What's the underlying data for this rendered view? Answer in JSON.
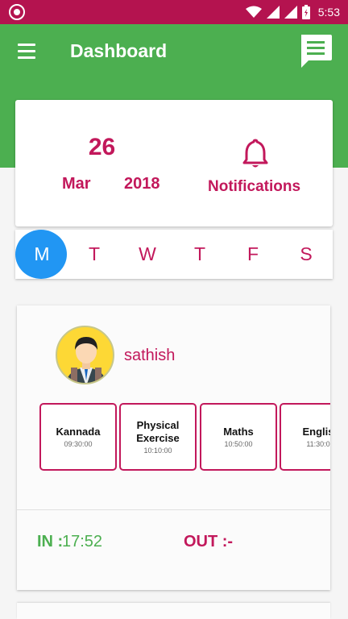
{
  "status_bar": {
    "time": "5:53",
    "color": "#b4134f",
    "icons": [
      "notification-circle-icon",
      "wifi-icon",
      "signal-icon",
      "signal-icon",
      "battery-icon"
    ]
  },
  "app_bar": {
    "title": "Dashboard",
    "color": "#4caf50",
    "icons": [
      "menu-icon",
      "chat-icon"
    ]
  },
  "date_card": {
    "day": "26",
    "month": "Mar",
    "year": "2018",
    "notifications_label": "Notifications",
    "icon": "bell-icon",
    "accent": "#c2185b"
  },
  "week": {
    "days": [
      "M",
      "T",
      "W",
      "T",
      "F",
      "S"
    ],
    "selected": "M",
    "selected_color": "#2196f3"
  },
  "student": {
    "name": "sathish",
    "avatar_icon": "student-avatar-icon",
    "subjects": [
      {
        "name": "Kannada",
        "time": "09:30:00"
      },
      {
        "name": "Physical Exercise",
        "time": "10:10:00"
      },
      {
        "name": "Maths",
        "time": "10:50:00"
      },
      {
        "name": "Englis",
        "time": "11:30:0"
      }
    ],
    "in_label": "IN :",
    "in_value": "17:52",
    "out_label": "OUT :-"
  }
}
